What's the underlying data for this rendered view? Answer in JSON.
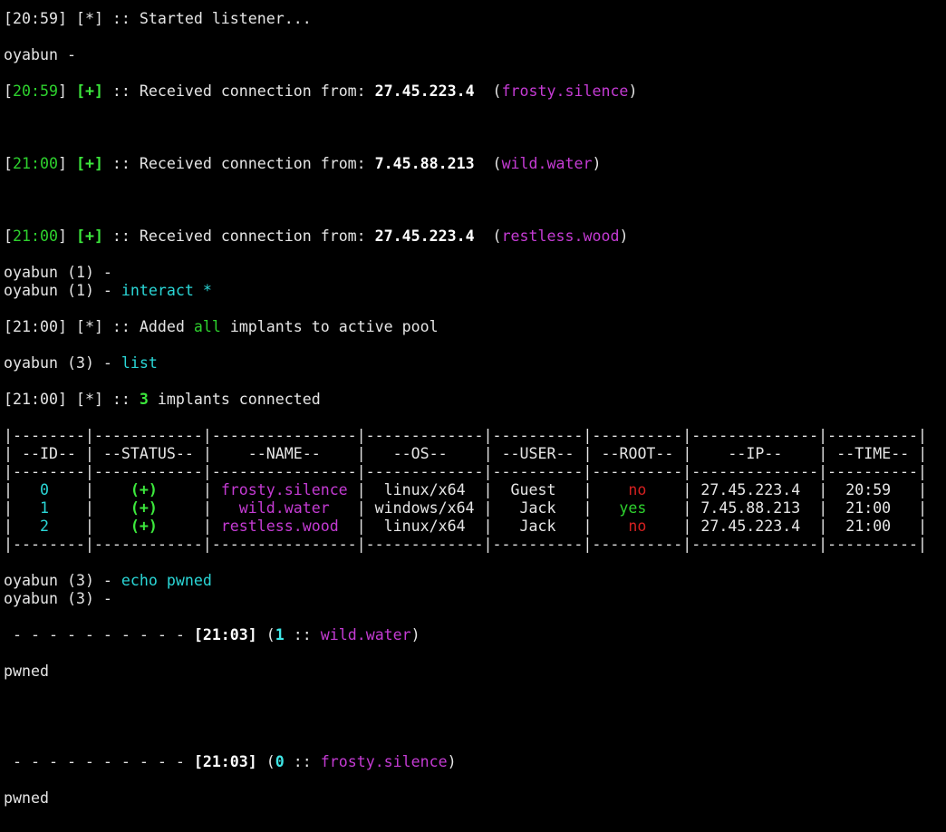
{
  "theme": {
    "background": "#000000",
    "foreground": "#e5e5e5",
    "green": "#2ed12e",
    "cyan": "#2ad6d6",
    "magenta": "#c43bd3",
    "red": "#d42020"
  },
  "log": {
    "l0_time": "20:59",
    "l0_tag": "*",
    "l0_msg": "Started listener...",
    "prompt_name": "oyabun",
    "conn1": {
      "time": "20:59",
      "tag": "+",
      "msg": "Received connection from:",
      "ip": "27.45.223.4",
      "name": "frosty.silence"
    },
    "conn2": {
      "time": "21:00",
      "tag": "+",
      "msg": "Received connection from:",
      "ip": "7.45.88.213",
      "name": "wild.water"
    },
    "conn3": {
      "time": "21:00",
      "tag": "+",
      "msg": "Received connection from:",
      "ip": "27.45.223.4",
      "name": "restless.wood"
    },
    "p1_count": "1",
    "cmd_interact": "interact *",
    "added": {
      "time": "21:00",
      "tag": "*",
      "pre": "Added",
      "word": "all",
      "post": "implants to active pool"
    },
    "p3_count": "3",
    "cmd_list": "list",
    "connected": {
      "time": "21:00",
      "tag": "*",
      "count": "3",
      "msg": "implants connected"
    },
    "cmd_echo": "echo pwned",
    "resp1": {
      "dashes": "- - - - - - - - - -",
      "time": "21:03",
      "id": "1",
      "sep": "::",
      "name": "wild.water",
      "output": "pwned"
    },
    "resp2": {
      "dashes": "- - - - - - - - - -",
      "time": "21:03",
      "id": "0",
      "sep": "::",
      "name": "frosty.silence",
      "output": "pwned"
    }
  },
  "table": {
    "headers": {
      "id": "--ID--",
      "status": "--STATUS--",
      "name": "--NAME--",
      "os": "--OS--",
      "user": "--USER--",
      "root": "--ROOT--",
      "ip": "--IP--",
      "time": "--TIME--"
    },
    "rows": [
      {
        "id": "0",
        "status": "(+)",
        "name": "frosty.silence",
        "os": "linux/x64",
        "user": "Guest",
        "root": "no",
        "ip": "27.45.223.4",
        "time": "20:59"
      },
      {
        "id": "1",
        "status": "(+)",
        "name": "wild.water",
        "os": "windows/x64",
        "user": "Jack",
        "root": "yes",
        "ip": "7.45.88.213",
        "time": "21:00"
      },
      {
        "id": "2",
        "status": "(+)",
        "name": "restless.wood",
        "os": "linux/x64",
        "user": "Jack",
        "root": "no",
        "ip": "27.45.223.4",
        "time": "21:00"
      }
    ]
  }
}
